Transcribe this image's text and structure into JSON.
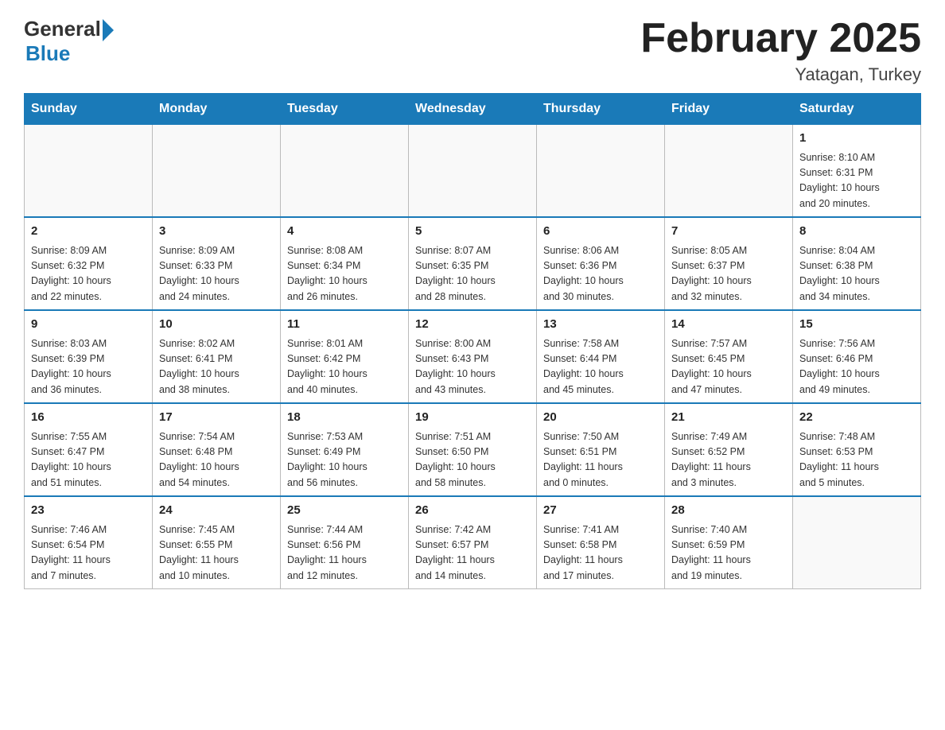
{
  "logo": {
    "general": "General",
    "blue": "Blue"
  },
  "header": {
    "title": "February 2025",
    "location": "Yatagan, Turkey"
  },
  "weekdays": [
    "Sunday",
    "Monday",
    "Tuesday",
    "Wednesday",
    "Thursday",
    "Friday",
    "Saturday"
  ],
  "weeks": [
    [
      {
        "day": "",
        "info": ""
      },
      {
        "day": "",
        "info": ""
      },
      {
        "day": "",
        "info": ""
      },
      {
        "day": "",
        "info": ""
      },
      {
        "day": "",
        "info": ""
      },
      {
        "day": "",
        "info": ""
      },
      {
        "day": "1",
        "info": "Sunrise: 8:10 AM\nSunset: 6:31 PM\nDaylight: 10 hours\nand 20 minutes."
      }
    ],
    [
      {
        "day": "2",
        "info": "Sunrise: 8:09 AM\nSunset: 6:32 PM\nDaylight: 10 hours\nand 22 minutes."
      },
      {
        "day": "3",
        "info": "Sunrise: 8:09 AM\nSunset: 6:33 PM\nDaylight: 10 hours\nand 24 minutes."
      },
      {
        "day": "4",
        "info": "Sunrise: 8:08 AM\nSunset: 6:34 PM\nDaylight: 10 hours\nand 26 minutes."
      },
      {
        "day": "5",
        "info": "Sunrise: 8:07 AM\nSunset: 6:35 PM\nDaylight: 10 hours\nand 28 minutes."
      },
      {
        "day": "6",
        "info": "Sunrise: 8:06 AM\nSunset: 6:36 PM\nDaylight: 10 hours\nand 30 minutes."
      },
      {
        "day": "7",
        "info": "Sunrise: 8:05 AM\nSunset: 6:37 PM\nDaylight: 10 hours\nand 32 minutes."
      },
      {
        "day": "8",
        "info": "Sunrise: 8:04 AM\nSunset: 6:38 PM\nDaylight: 10 hours\nand 34 minutes."
      }
    ],
    [
      {
        "day": "9",
        "info": "Sunrise: 8:03 AM\nSunset: 6:39 PM\nDaylight: 10 hours\nand 36 minutes."
      },
      {
        "day": "10",
        "info": "Sunrise: 8:02 AM\nSunset: 6:41 PM\nDaylight: 10 hours\nand 38 minutes."
      },
      {
        "day": "11",
        "info": "Sunrise: 8:01 AM\nSunset: 6:42 PM\nDaylight: 10 hours\nand 40 minutes."
      },
      {
        "day": "12",
        "info": "Sunrise: 8:00 AM\nSunset: 6:43 PM\nDaylight: 10 hours\nand 43 minutes."
      },
      {
        "day": "13",
        "info": "Sunrise: 7:58 AM\nSunset: 6:44 PM\nDaylight: 10 hours\nand 45 minutes."
      },
      {
        "day": "14",
        "info": "Sunrise: 7:57 AM\nSunset: 6:45 PM\nDaylight: 10 hours\nand 47 minutes."
      },
      {
        "day": "15",
        "info": "Sunrise: 7:56 AM\nSunset: 6:46 PM\nDaylight: 10 hours\nand 49 minutes."
      }
    ],
    [
      {
        "day": "16",
        "info": "Sunrise: 7:55 AM\nSunset: 6:47 PM\nDaylight: 10 hours\nand 51 minutes."
      },
      {
        "day": "17",
        "info": "Sunrise: 7:54 AM\nSunset: 6:48 PM\nDaylight: 10 hours\nand 54 minutes."
      },
      {
        "day": "18",
        "info": "Sunrise: 7:53 AM\nSunset: 6:49 PM\nDaylight: 10 hours\nand 56 minutes."
      },
      {
        "day": "19",
        "info": "Sunrise: 7:51 AM\nSunset: 6:50 PM\nDaylight: 10 hours\nand 58 minutes."
      },
      {
        "day": "20",
        "info": "Sunrise: 7:50 AM\nSunset: 6:51 PM\nDaylight: 11 hours\nand 0 minutes."
      },
      {
        "day": "21",
        "info": "Sunrise: 7:49 AM\nSunset: 6:52 PM\nDaylight: 11 hours\nand 3 minutes."
      },
      {
        "day": "22",
        "info": "Sunrise: 7:48 AM\nSunset: 6:53 PM\nDaylight: 11 hours\nand 5 minutes."
      }
    ],
    [
      {
        "day": "23",
        "info": "Sunrise: 7:46 AM\nSunset: 6:54 PM\nDaylight: 11 hours\nand 7 minutes."
      },
      {
        "day": "24",
        "info": "Sunrise: 7:45 AM\nSunset: 6:55 PM\nDaylight: 11 hours\nand 10 minutes."
      },
      {
        "day": "25",
        "info": "Sunrise: 7:44 AM\nSunset: 6:56 PM\nDaylight: 11 hours\nand 12 minutes."
      },
      {
        "day": "26",
        "info": "Sunrise: 7:42 AM\nSunset: 6:57 PM\nDaylight: 11 hours\nand 14 minutes."
      },
      {
        "day": "27",
        "info": "Sunrise: 7:41 AM\nSunset: 6:58 PM\nDaylight: 11 hours\nand 17 minutes."
      },
      {
        "day": "28",
        "info": "Sunrise: 7:40 AM\nSunset: 6:59 PM\nDaylight: 11 hours\nand 19 minutes."
      },
      {
        "day": "",
        "info": ""
      }
    ]
  ]
}
